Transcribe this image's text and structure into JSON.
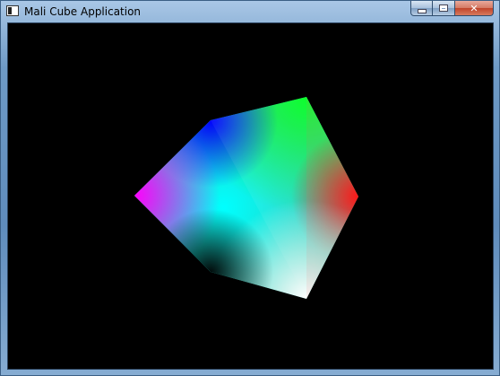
{
  "window": {
    "title": "Mali Cube Application",
    "app_icon": "console-window-icon",
    "controls": {
      "minimize_icon": "minimize-icon",
      "maximize_icon": "maximize-icon",
      "close_label": "✕"
    }
  },
  "scene": {
    "background": "#000000",
    "object": "rotating-cube",
    "vertex_colors": [
      "#ff00ff",
      "#0000ff",
      "#00ff00",
      "#ff0000",
      "#ffffff",
      "#000000",
      "#00ffff"
    ]
  }
}
